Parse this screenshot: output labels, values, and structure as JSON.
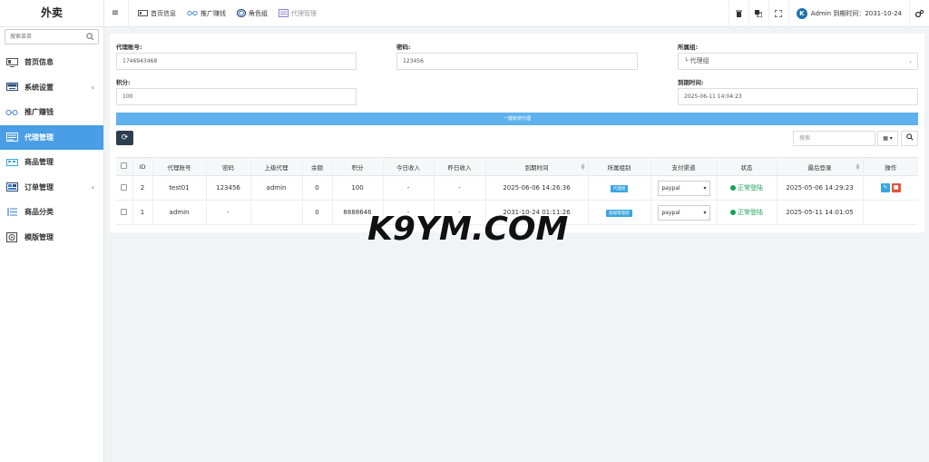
{
  "brand": "外卖",
  "search": {
    "placeholder": "搜索菜单"
  },
  "sidebar": {
    "items": [
      {
        "label": "首页信息",
        "icon": "monitor-icon"
      },
      {
        "label": "系统设置",
        "icon": "keyboard-icon",
        "arrow": "‹"
      },
      {
        "label": "推广赚钱",
        "icon": "glasses-icon"
      },
      {
        "label": "代理管理",
        "icon": "agent-icon",
        "active": true
      },
      {
        "label": "商品管理",
        "icon": "goods-icon"
      },
      {
        "label": "订单管理",
        "icon": "order-icon",
        "arrow": "‹"
      },
      {
        "label": "商品分类",
        "icon": "category-icon"
      },
      {
        "label": "模版管理",
        "icon": "template-icon"
      }
    ]
  },
  "topbar": {
    "menu_icon": "≡",
    "tabs": [
      {
        "label": "首页信息"
      },
      {
        "label": "推广赚钱"
      },
      {
        "label": "角色组"
      },
      {
        "label": "代理管理"
      }
    ],
    "user": {
      "avatar": "K",
      "text": "Admin 到期时间：2031-10-24"
    }
  },
  "form": {
    "account_label": "代理账号:",
    "account_value": "1746943468",
    "password_label": "密码:",
    "password_value": "123456",
    "group_label": "所属组:",
    "group_value": "└ 代理组",
    "points_label": "积分:",
    "points_value": "100",
    "expire_label": "到期时间:",
    "expire_value": "2025-06-11 14:04:23",
    "submit_label": "一键新增代理"
  },
  "toolbar": {
    "refresh": "⟳",
    "search_placeholder": "搜索",
    "columns": "▦ ▾",
    "find": "⌕"
  },
  "table": {
    "headers": [
      "ID",
      "代理账号",
      "密码",
      "上级代理",
      "余额",
      "积分",
      "今日收入",
      "昨日收入",
      "到期时间",
      "所属组别",
      "支付渠道",
      "状态",
      "最后登录",
      "操作"
    ],
    "rows": [
      {
        "id": "2",
        "account": "test01",
        "password": "123456",
        "parent": "admin",
        "balance": "0",
        "points": "100",
        "today": "-",
        "yesterday": "-",
        "expire": "2025-06-06 14:26:36",
        "group": "代理组",
        "pay": "paypal",
        "status": "正常登陆",
        "last_login": "2025-05-06 14:29:23"
      },
      {
        "id": "1",
        "account": "admin",
        "password": "-",
        "parent": "",
        "balance": "0",
        "points": "8888646",
        "today": "-",
        "yesterday": "-",
        "expire": "2031-10-24 01:11:26",
        "group": "超级管理组",
        "pay": "paypal",
        "status": "正常登陆",
        "last_login": "2025-05-11 14:01:05"
      }
    ]
  },
  "watermark": "K9YM.COM",
  "colors": {
    "accent": "#4a9ee6",
    "submit": "#5fb1ee",
    "status_ok": "#18a058",
    "delete": "#e0553a"
  }
}
